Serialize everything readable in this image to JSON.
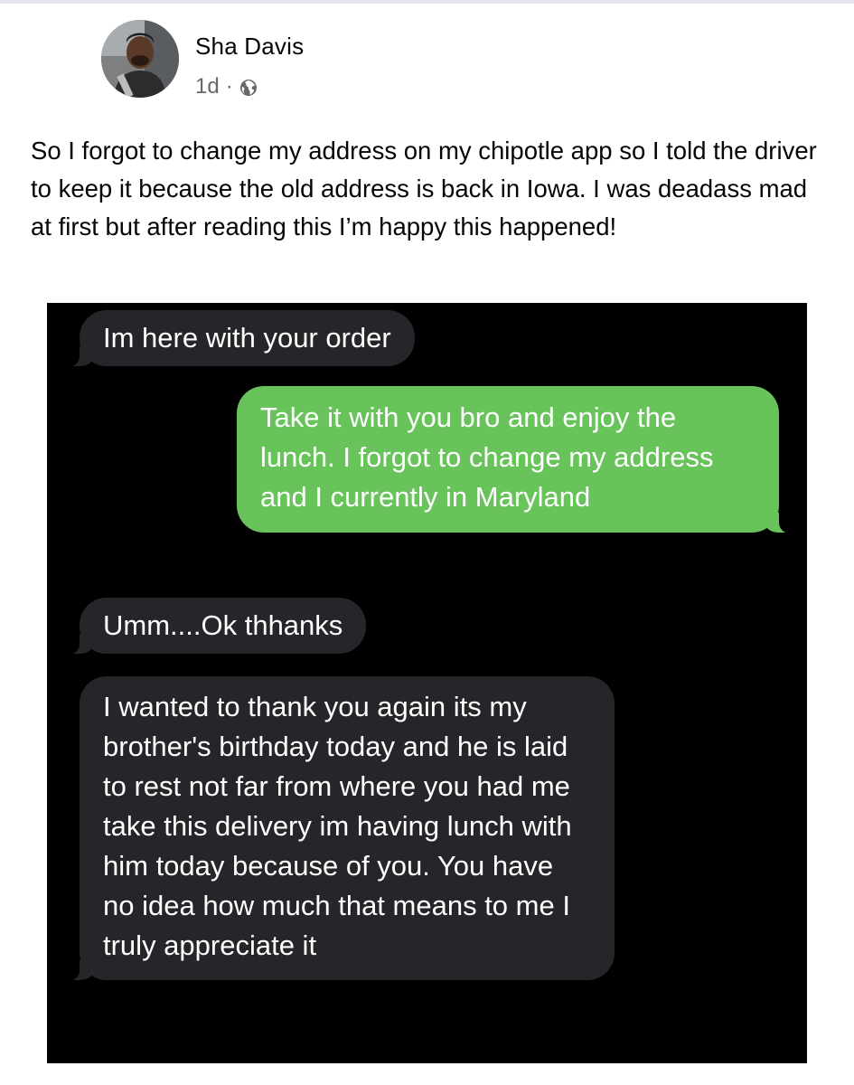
{
  "post": {
    "author": "Sha Davis",
    "time": "1d",
    "separator": "·",
    "audience_icon": "globe-icon",
    "text": "So I forgot to change my address on my chipotle app so I told the driver to keep it because the old address is back in Iowa. I was deadass mad at first but after reading this I’m happy this happened!"
  },
  "messages": [
    {
      "direction": "incoming",
      "text": "Im here with your order"
    },
    {
      "direction": "outgoing",
      "text": "Take it with you bro and enjoy the lunch. I forgot to change my address and I currently in Maryland"
    },
    {
      "direction": "incoming",
      "text": "Umm....Ok thhanks"
    },
    {
      "direction": "incoming",
      "text": "I wanted to thank you again its my brother's birthday today and he is laid to rest not far from where you had me take this delivery im having lunch with him today because of you. You have no idea how much that means to me I truly appreciate it"
    }
  ],
  "colors": {
    "incoming_bubble": "#262529",
    "outgoing_bubble": "#67c35a",
    "thread_background": "#000000",
    "meta_text": "#65676b"
  }
}
